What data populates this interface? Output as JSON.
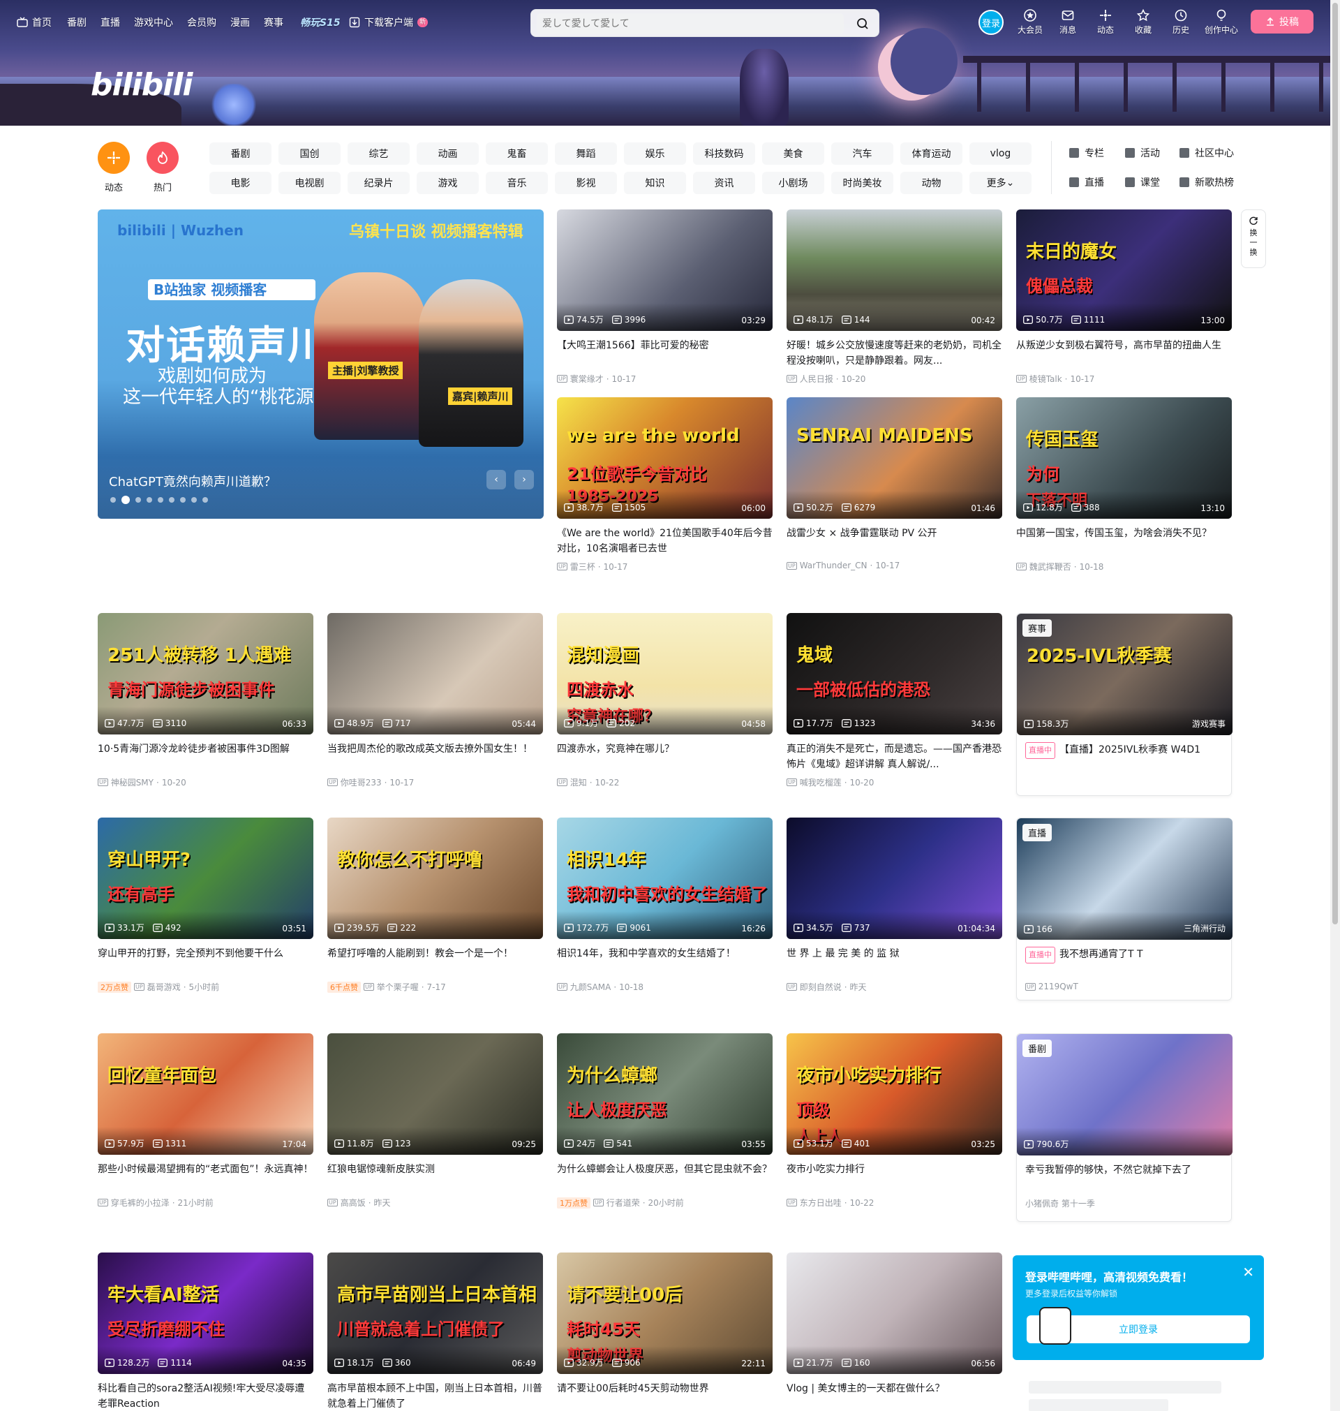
{
  "topnav": {
    "left": [
      "首页",
      "番剧",
      "直播",
      "游戏中心",
      "会员购",
      "漫画",
      "赛事",
      "畅玩S15",
      "下载客户端"
    ],
    "new_badge": "新",
    "search_placeholder": "爱して愛して愛して",
    "login": "登录",
    "right": [
      "大会员",
      "消息",
      "动态",
      "收藏",
      "历史",
      "创作中心"
    ],
    "upload": "投稿"
  },
  "logo": "bilibili",
  "channels": {
    "circles": [
      "动态",
      "热门"
    ],
    "row1": [
      "番剧",
      "国创",
      "综艺",
      "动画",
      "鬼畜",
      "舞蹈",
      "娱乐",
      "科技数码",
      "美食",
      "汽车",
      "体育运动",
      "vlog"
    ],
    "row2": [
      "电影",
      "电视剧",
      "纪录片",
      "游戏",
      "音乐",
      "影视",
      "知识",
      "资讯",
      "小剧场",
      "时尚美妆",
      "动物",
      "更多"
    ],
    "right": [
      "专栏",
      "活动",
      "社区中心",
      "直播",
      "课堂",
      "新歌热榜"
    ]
  },
  "carousel": {
    "brand": "bilibili | Wuzhen",
    "top_text": "乌镇十日谈 视频播客特辑",
    "tag": "B站独家 视频播客",
    "headline": "对话赖声川",
    "sub1": "戏剧如何成为",
    "sub2": "这一代年轻人的“桃花源”？",
    "host": "主播|刘擎教授",
    "guest": "嘉宾|赖声川",
    "caption": "ChatGPT竟然向赖声川道歉？",
    "prev": "‹",
    "next": "›"
  },
  "refresh": [
    "换",
    "一",
    "换"
  ],
  "cards": [
    {
      "views": "74.5万",
      "danmaku": "3996",
      "dur": "03:29",
      "title": "【大鸣王潮1566】菲比可爱的秘密",
      "up": "寰棠缘才",
      "date": "10-17"
    },
    {
      "views": "48.1万",
      "danmaku": "144",
      "dur": "00:42",
      "title": "好暖！城乡公交放慢速度等赶来的老奶奶，司机全程没按喇叭，只是静静跟着。网友...",
      "up": "人民日报",
      "date": "10-20"
    },
    {
      "views": "50.7万",
      "danmaku": "1111",
      "dur": "13:00",
      "title": "从叛逆少女到极右翼符号，高市早苗的扭曲人生",
      "up": "棱镜Talk",
      "date": "10-17",
      "overlay1": "末日的魔女",
      "overlay2": "傀儡总裁"
    },
    {
      "views": "38.7万",
      "danmaku": "1505",
      "dur": "06:00",
      "title": "《We are the world》21位美国歌手40年后今昔对比，10名演唱者已去世",
      "up": "雷三杯",
      "date": "10-17",
      "overlay1": "we are the world",
      "overlay2": "21位歌手今昔对比",
      "overlay3": "1985-2025"
    },
    {
      "views": "50.2万",
      "danmaku": "6279",
      "dur": "01:46",
      "title": "战雷少女 × 战争雷霆联动 PV 公开",
      "up": "WarThunder_CN",
      "date": "10-17",
      "overlay1": "SENRAI MAIDENS"
    },
    {
      "views": "12.8万",
      "danmaku": "388",
      "dur": "13:10",
      "title": "中国第一国宝，传国玉玺，为啥会消失不见？",
      "up": "魏武挥鞭否",
      "date": "10-18",
      "overlay1": "传国玉玺",
      "overlay2": "为何",
      "overlay3": "下落不明"
    },
    {
      "views": "47.7万",
      "danmaku": "3110",
      "dur": "06:33",
      "title": "10·5青海门源冷龙岭徒步者被困事件3D图解",
      "up": "神秘园SMY",
      "date": "10-20",
      "overlay1": "251人被转移 1人遇难",
      "overlay2": "青海门源徒步被困事件"
    },
    {
      "views": "48.9万",
      "danmaku": "717",
      "dur": "05:44",
      "title": "当我把周杰伦的歌改成英文版去撩外国女生！！",
      "up": "你哇哥233",
      "date": "10-17"
    },
    {
      "views": "9.1万",
      "danmaku": "202",
      "dur": "04:58",
      "title": "四渡赤水，究竟神在哪儿？",
      "up": "混知",
      "date": "10-22",
      "overlay1": "混知漫画",
      "overlay2": "四渡赤水",
      "overlay3": "究竟神在哪？"
    },
    {
      "views": "17.7万",
      "danmaku": "1323",
      "dur": "34:36",
      "title": "真正的消失不是死亡，而是遗忘。——国产香港恐怖片《鬼域》超详讲解 真人解说/...",
      "up": "喊我吃榴莲",
      "date": "10-20",
      "overlay1": "鬼域",
      "overlay2": "一部被低估的港恐"
    },
    {
      "corner": "赛事",
      "views": "158.3万",
      "righttag": "游戏赛事",
      "live": "直播中",
      "title": "【直播】2025IVL秋季赛 W4D1",
      "overlay1": "2025-IVL秋季赛"
    },
    {
      "views": "33.1万",
      "danmaku": "492",
      "dur": "03:51",
      "title": "穿山甲开的打野，完全预判不到他要干什么",
      "hot": "2万点赞",
      "up": "磊哥游戏",
      "date": "5小时前",
      "overlay1": "穿山甲开?",
      "overlay2": "还有高手"
    },
    {
      "views": "239.5万",
      "danmaku": "222",
      "dur": "",
      "title": "希望打呼噜的人能刷到！教会一个是一个！",
      "hot": "6千点赞",
      "up": "举个栗子喔",
      "date": "7-17",
      "overlay1": "教你怎么不打呼噜"
    },
    {
      "views": "172.7万",
      "danmaku": "9061",
      "dur": "16:26",
      "title": "相识14年，我和中学喜欢的女生结婚了！",
      "up": "九颜SAMA",
      "date": "10-18",
      "overlay1": "相识14年",
      "overlay2": "我和初中喜欢的女生结婚了"
    },
    {
      "views": "34.5万",
      "danmaku": "737",
      "dur": "01:04:34",
      "title": "世 界 上 最 完 美 的 监 狱",
      "up": "即刻自然说",
      "date": "昨天"
    },
    {
      "corner": "直播",
      "views": "166",
      "righttag": "三角洲行动",
      "live": "直播中",
      "title": "我不想再通宵了T T",
      "up": "2119QwT",
      "date": ""
    },
    {
      "views": "57.9万",
      "danmaku": "1311",
      "dur": "17:04",
      "title": "那些小时候最渴望拥有的“老式面包”！永远真神！",
      "up": "穿毛裤的小拉泽",
      "date": "21小时前",
      "overlay1": "回忆童年面包"
    },
    {
      "views": "11.8万",
      "danmaku": "123",
      "dur": "09:25",
      "title": "红狼电锯惊魂新皮肤实测",
      "up": "高高饭",
      "date": "昨天"
    },
    {
      "views": "24万",
      "danmaku": "541",
      "dur": "03:55",
      "title": "为什么蟑螂会让人极度厌恶，但其它昆虫就不会？",
      "hot": "1万点赞",
      "up": "行者道荣",
      "date": "20小时前",
      "overlay1": "为什么蟑螂",
      "overlay2": "让人极度厌恶"
    },
    {
      "views": "53.1万",
      "danmaku": "401",
      "dur": "03:25",
      "title": "夜市小吃实力排行",
      "up": "东方日出哇",
      "date": "10-22",
      "overlay1": "夜市小吃实力排行",
      "overlay2": "顶级",
      "overlay3": "人上人"
    },
    {
      "corner": "番剧",
      "views": "790.6万",
      "title": "幸亏我暂停的够快，不然它就掉下去了",
      "up": "小猪佩奇 第十一季",
      "date": ""
    },
    {
      "views": "128.2万",
      "danmaku": "1114",
      "dur": "04:35",
      "title": "科比看自己的sora2整活AI视频!牢大受尽凌辱遭老罪Reaction",
      "overlay1": "牢大看AI整活",
      "overlay2": "受尽折磨绷不住"
    },
    {
      "views": "18.1万",
      "danmaku": "360",
      "dur": "06:49",
      "title": "高市早苗根本顾不上中国，刚当上日本首相，川普就急着上门催债了",
      "overlay1": "高市早苗刚当上日本首相",
      "overlay2": "川普就急着上门催债了"
    },
    {
      "views": "32.9万",
      "danmaku": "906",
      "dur": "22:11",
      "title": "请不要让00后耗时45天剪动物世界",
      "overlay1": "请不要让00后",
      "overlay2": "耗时45天",
      "overlay3": "剪动物世界"
    },
    {
      "views": "21.7万",
      "danmaku": "160",
      "dur": "06:56",
      "title": "Vlog | 美女博主的一天都在做什么？"
    }
  ],
  "login_popup": {
    "title": "登录哔哩哔哩，高清视频免费看！",
    "sub": "更多登录后权益等你解锁",
    "button": "立即登录",
    "close": "✕"
  }
}
